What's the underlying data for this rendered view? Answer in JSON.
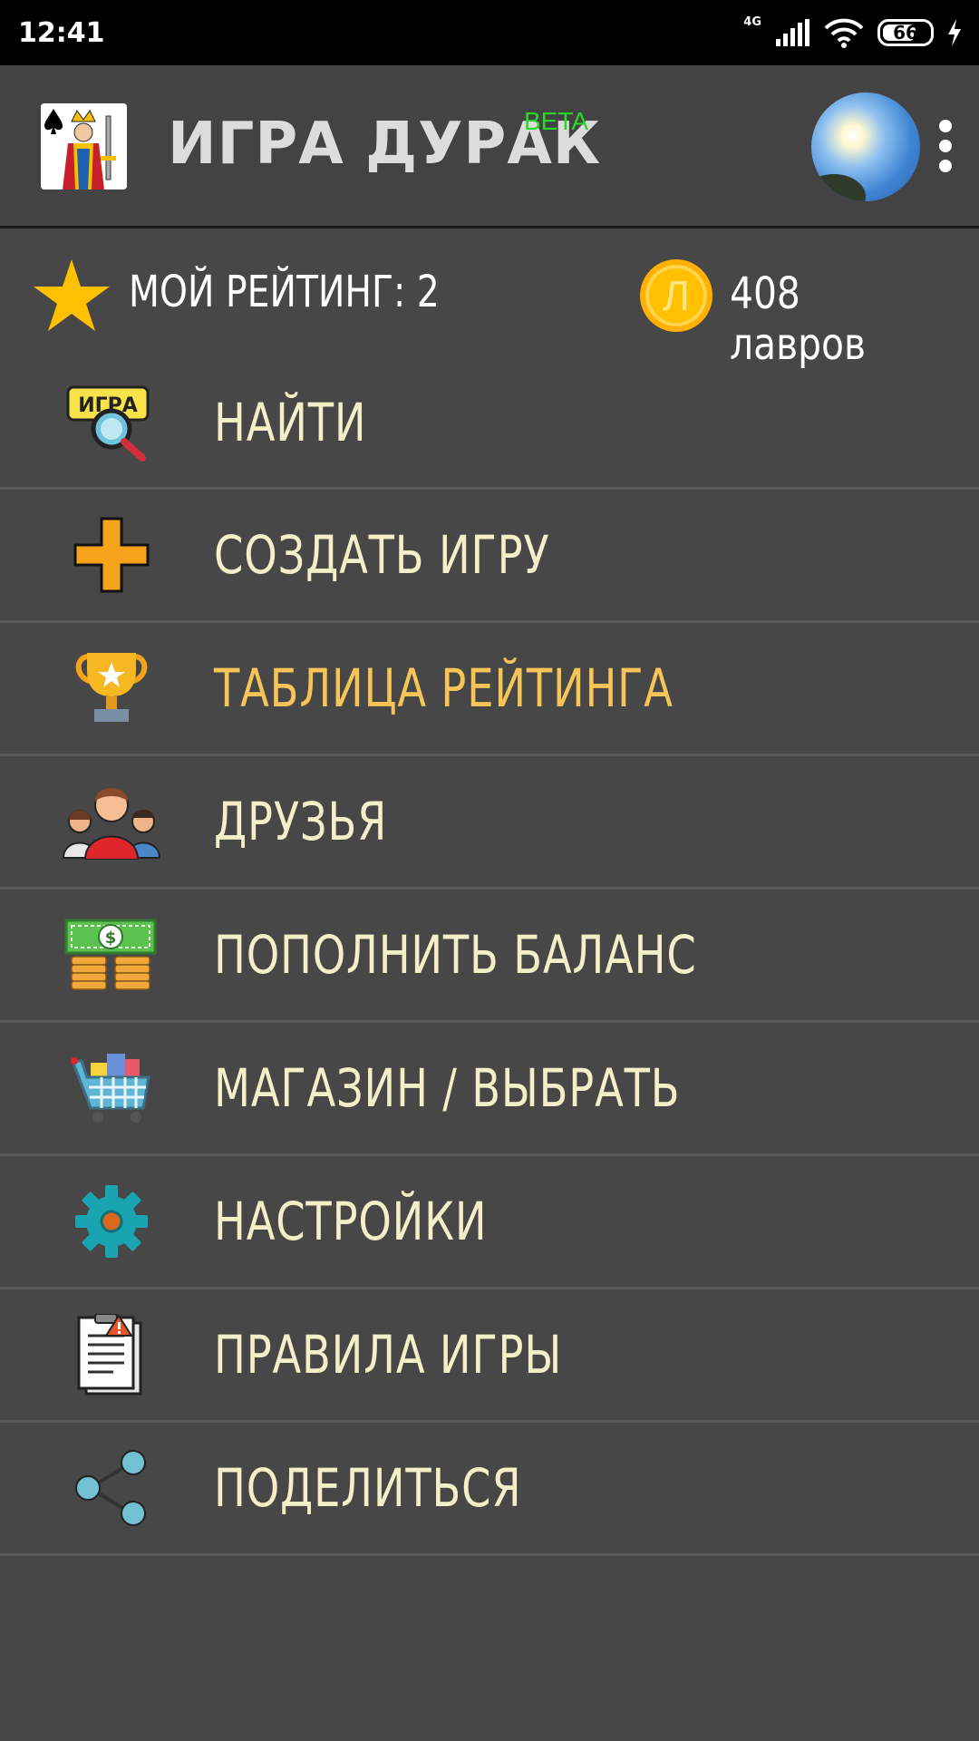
{
  "status_bar": {
    "time": "12:41",
    "network": "4G",
    "battery": "66"
  },
  "header": {
    "title": "ИГРА ДУРАК",
    "badge": "BETA",
    "logo_icon": "king-of-spades-card-icon",
    "avatar_icon": "sky-sun-avatar",
    "menu_icon": "kebab-menu-icon"
  },
  "stats": {
    "rating_label": "МОЙ РЕЙТИНГ: 2",
    "coin_symbol": "Л",
    "balance": "408 лавров",
    "colors": {
      "star": "#ffc000",
      "coin": "#ffc000"
    }
  },
  "menu": {
    "items": [
      {
        "label": "НАЙТИ",
        "icon": "search-game-icon"
      },
      {
        "label": "СОЗДАТЬ ИГРУ",
        "icon": "plus-icon"
      },
      {
        "label": "ТАБЛИЦА РЕЙТИНГА",
        "icon": "trophy-icon",
        "highlighted": true
      },
      {
        "label": "ДРУЗЬЯ",
        "icon": "friends-icon"
      },
      {
        "label": "ПОПОЛНИТЬ БАЛАНС",
        "icon": "money-icon"
      },
      {
        "label": "МАГАЗИН / ВЫБРАТЬ",
        "icon": "shopping-cart-icon"
      },
      {
        "label": "НАСТРОЙКИ",
        "icon": "gear-icon"
      },
      {
        "label": "ПРАВИЛА ИГРЫ",
        "icon": "rules-clipboard-icon"
      },
      {
        "label": "ПОДЕЛИТЬСЯ",
        "icon": "share-icon"
      }
    ],
    "colors": {
      "label": "#f3f0c8",
      "highlight": "#f6c457"
    }
  }
}
